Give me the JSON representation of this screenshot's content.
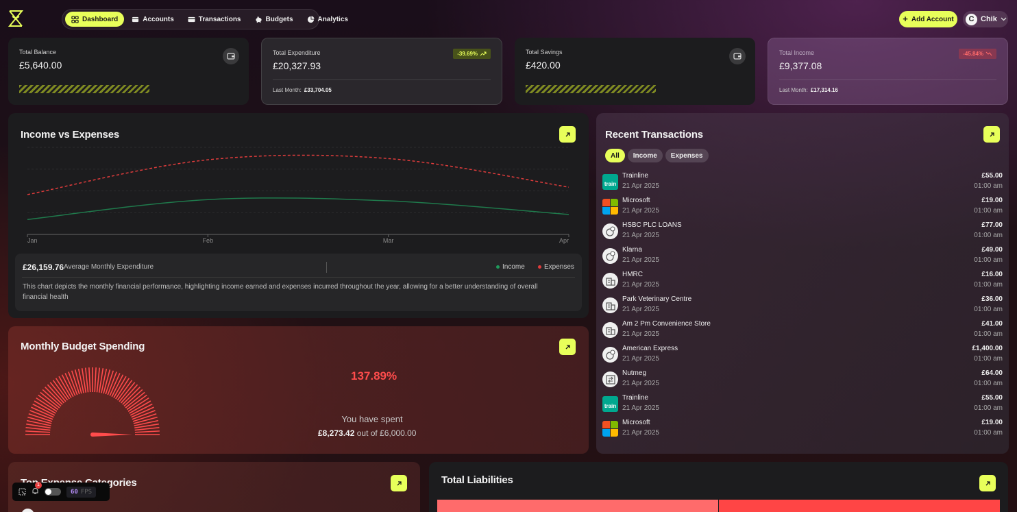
{
  "nav": {
    "items": [
      {
        "label": "Dashboard",
        "icon": "dashboard-icon",
        "active": true
      },
      {
        "label": "Accounts",
        "icon": "wallet-icon",
        "active": false
      },
      {
        "label": "Transactions",
        "icon": "card-icon",
        "active": false
      },
      {
        "label": "Budgets",
        "icon": "piggy-bank-icon",
        "active": false
      },
      {
        "label": "Analytics",
        "icon": "pie-chart-icon",
        "active": false
      }
    ],
    "add_account": "Add Account",
    "user_initial": "C",
    "user_name": "Chik"
  },
  "stats": {
    "balance": {
      "label": "Total Balance",
      "value": "£5,640.00"
    },
    "expenditure": {
      "label": "Total Expenditure",
      "value": "£20,327.93",
      "change": "-39.69%",
      "last_month_label": "Last Month:",
      "last_month": "£33,704.05"
    },
    "savings": {
      "label": "Total Savings",
      "value": "£420.00"
    },
    "income": {
      "label": "Total Income",
      "value": "£9,377.08",
      "change": "-45.84%",
      "last_month_label": "Last Month:",
      "last_month": "£17,314.16"
    }
  },
  "income_vs_expenses": {
    "title": "Income vs Expenses",
    "avg_value": "£26,159.76",
    "avg_label": "Average Monthly Expenditure",
    "legend_income": "Income",
    "legend_expenses": "Expenses",
    "description": "This chart depicts the monthly financial performance, highlighting income earned and expenses incurred throughout the year, allowing for a better understanding of overall financial health"
  },
  "chart_data": {
    "type": "line",
    "x": [
      "Jan",
      "Feb",
      "Mar",
      "Apr"
    ],
    "series": [
      {
        "name": "Income",
        "values": [
          6000,
          14000,
          13500,
          8000
        ],
        "color": "#1f7a4c"
      },
      {
        "name": "Expenses",
        "values": [
          16000,
          30000,
          30500,
          19000
        ],
        "color": "#e03c3c"
      }
    ],
    "ylim": [
      0,
      35000
    ],
    "grid": true
  },
  "budget": {
    "title": "Monthly Budget Spending",
    "percent": "137.89%",
    "spent_label": "You have spent",
    "spent_amount": "£8,273.42",
    "out_of": "out of £6,000.00",
    "gauge_fraction": 1.0,
    "color": "#ff4c4c"
  },
  "recent": {
    "title": "Recent Transactions",
    "filters": [
      "All",
      "Income",
      "Expenses"
    ],
    "transactions": [
      {
        "name": "Trainline",
        "date": "21 Apr 2025",
        "amount": "£55.00",
        "time": "01:00 am",
        "logo": "trainline"
      },
      {
        "name": "Microsoft",
        "date": "21 Apr 2025",
        "amount": "£19.00",
        "time": "01:00 am",
        "logo": "microsoft"
      },
      {
        "name": "HSBC PLC LOANS",
        "date": "21 Apr 2025",
        "amount": "£77.00",
        "time": "01:00 am",
        "logo": "coin"
      },
      {
        "name": "Klarna",
        "date": "21 Apr 2025",
        "amount": "£49.00",
        "time": "01:00 am",
        "logo": "coin"
      },
      {
        "name": "HMRC",
        "date": "21 Apr 2025",
        "amount": "£16.00",
        "time": "01:00 am",
        "logo": "building"
      },
      {
        "name": "Park Veterinary Centre",
        "date": "21 Apr 2025",
        "amount": "£36.00",
        "time": "01:00 am",
        "logo": "building"
      },
      {
        "name": "Am 2 Pm Convenience Store",
        "date": "21 Apr 2025",
        "amount": "£41.00",
        "time": "01:00 am",
        "logo": "building"
      },
      {
        "name": "American Express",
        "date": "21 Apr 2025",
        "amount": "£1,400.00",
        "time": "01:00 am",
        "logo": "coin"
      },
      {
        "name": "Nutmeg",
        "date": "21 Apr 2025",
        "amount": "£64.00",
        "time": "01:00 am",
        "logo": "transfer"
      },
      {
        "name": "Trainline",
        "date": "21 Apr 2025",
        "amount": "£55.00",
        "time": "01:00 am",
        "logo": "trainline"
      },
      {
        "name": "Microsoft",
        "date": "21 Apr 2025",
        "amount": "£19.00",
        "time": "01:00 am",
        "logo": "microsoft"
      }
    ]
  },
  "top_expense": {
    "title": "Top Expense Categories"
  },
  "liabilities": {
    "title": "Total Liabilities"
  },
  "devbar": {
    "notif_count": "1",
    "fps": "60",
    "fps_label": "FPS"
  },
  "colors": {
    "accent": "#e8ff5a",
    "income": "#1f7a4c",
    "expense": "#e03c3c"
  }
}
